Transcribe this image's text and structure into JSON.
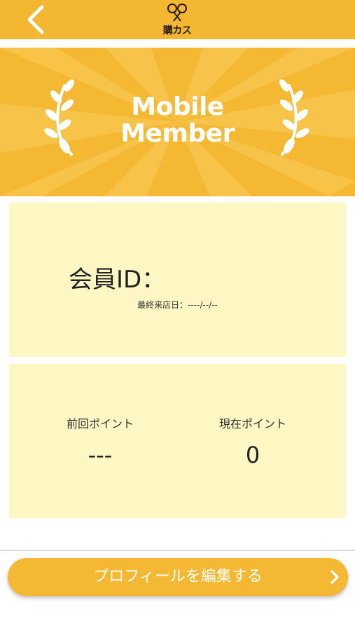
{
  "header": {
    "back_icon": "chevron-left-icon",
    "logo_icon": "scissors-logo-icon",
    "logo_text": "購カス",
    "background_color": "#f4b731"
  },
  "banner": {
    "title_line1": "Mobile",
    "title_line2": "Member",
    "left_icon": "laurel-left-icon",
    "right_icon": "laurel-right-icon",
    "background_color": "#f5b833"
  },
  "member_card": {
    "id_label": "会員ID：",
    "id_value": "",
    "last_visit_label": "最終来店日：",
    "last_visit_value": "----/--/--",
    "background_color": "#fef6c3"
  },
  "points_card": {
    "previous_label": "前回ポイント",
    "previous_value": "---",
    "current_label": "現在ポイント",
    "current_value": "0"
  },
  "actions": {
    "edit_profile_label": "プロフィールを編集する",
    "edit_profile_icon": "chevron-right-icon",
    "button_color": "#f5b833"
  }
}
